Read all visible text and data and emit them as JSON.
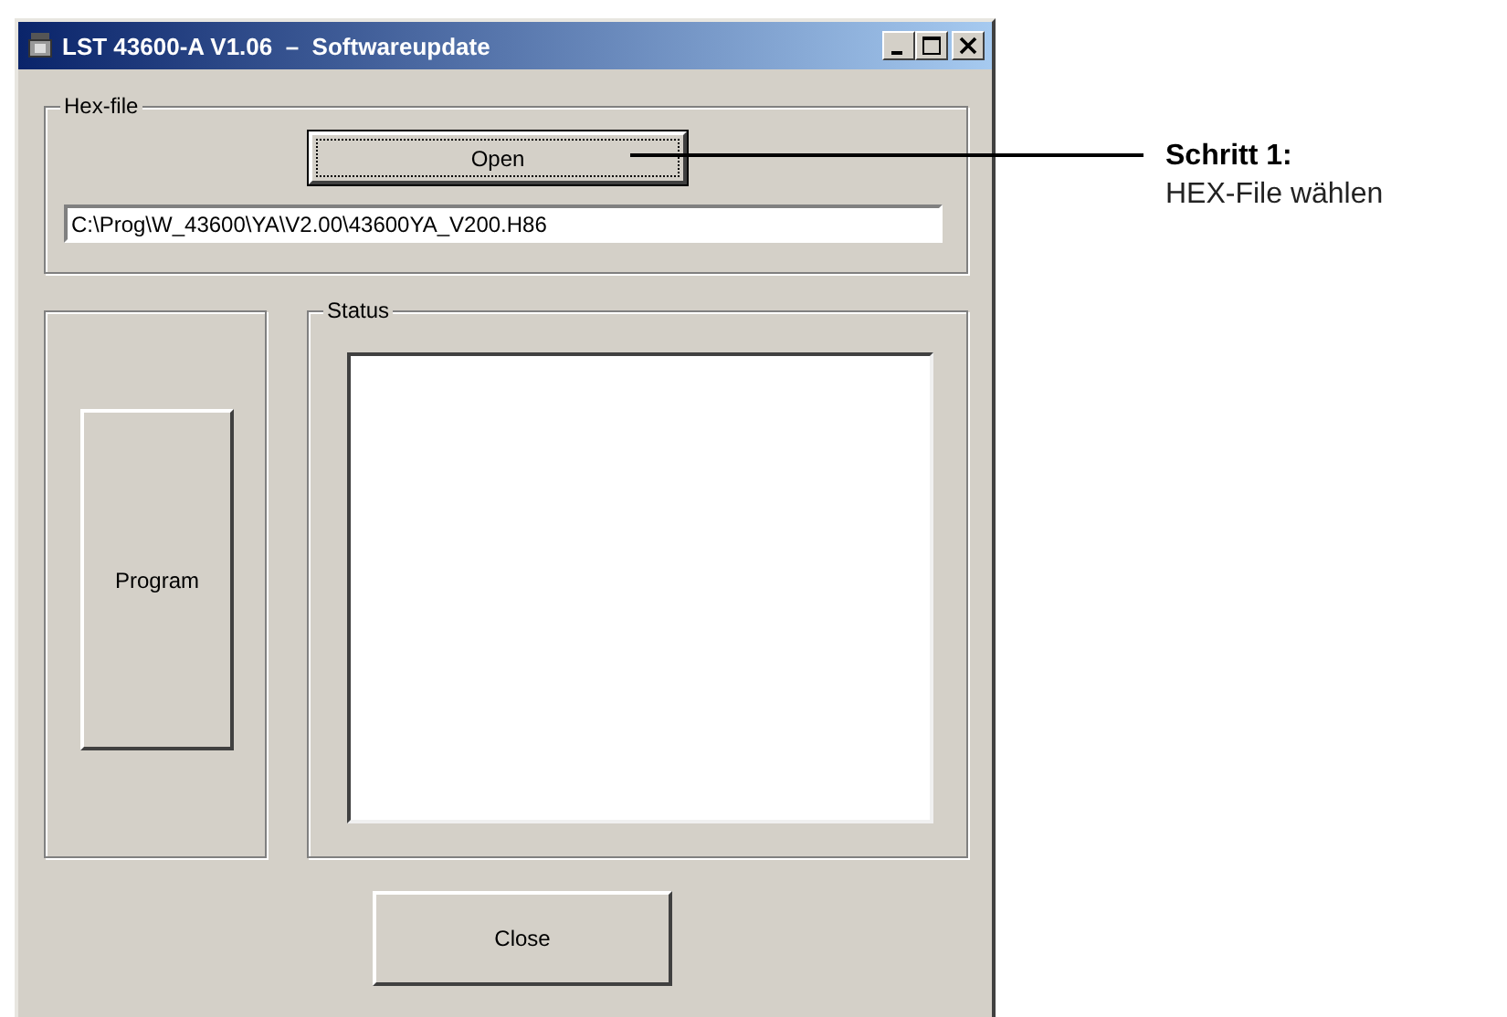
{
  "window": {
    "title": "LST 43600-A V1.06  –  Softwareupdate"
  },
  "hex_file": {
    "label": "Hex-file",
    "open_button": {
      "label": "Open",
      "focused": true
    },
    "path": "C:\\Prog\\W_43600\\YA\\V2.00\\43600YA_V200.H86"
  },
  "program_button": {
    "label": "Program"
  },
  "status": {
    "label": "Status"
  },
  "close_button": {
    "label": "Close"
  },
  "annotation": {
    "heading": "Schritt 1:",
    "text": "HEX-File wählen"
  }
}
